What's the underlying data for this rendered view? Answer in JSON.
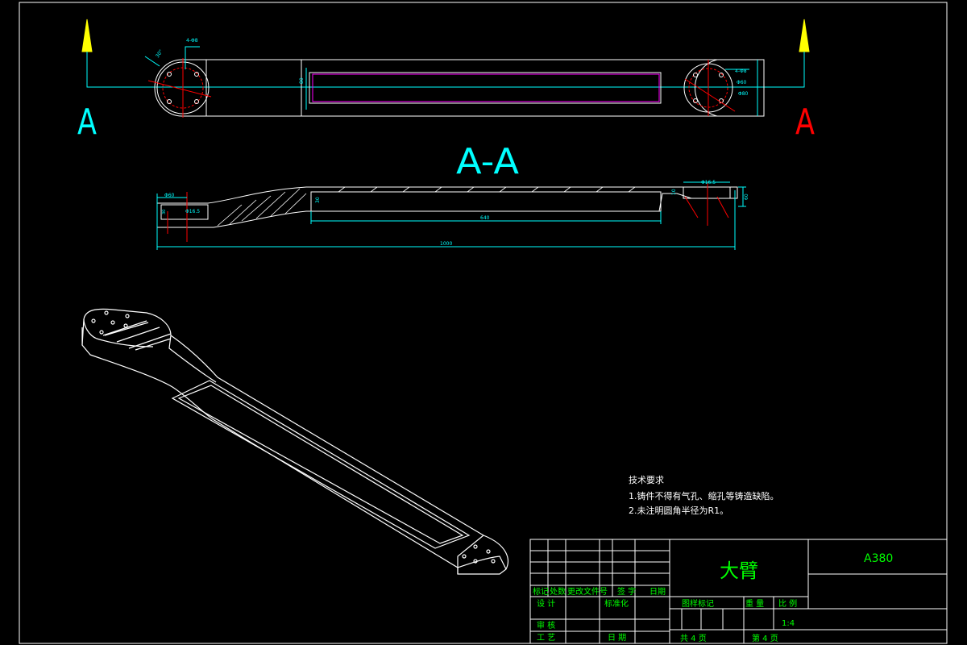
{
  "colors": {
    "background": "#000000",
    "line_white": "#ffffff",
    "dimension_cyan": "#00ffff",
    "section_red": "#ff0000",
    "slot_magenta": "#ff00ff",
    "arrow_yellow": "#ffff00",
    "title_green": "#00ff00"
  },
  "section_marks": {
    "left": "A",
    "right": "A",
    "title": "A-A"
  },
  "top_view_dims": {
    "hole_label_left": "4-Φ8",
    "hole_label_right": "4-Φ8",
    "angle_label": "30°",
    "thickness": "80",
    "right_dims": [
      "4-Φ8",
      "Φ60",
      "Φ80"
    ]
  },
  "section_dims": {
    "left_top": "Φ60",
    "left_hole": "Φ16.5",
    "left_depth": "30",
    "right_top": "Φ16.5",
    "right_height": "60",
    "right_small": "10",
    "slot_length": "640",
    "slot_depth": "30",
    "overall_length": "1000"
  },
  "technical_requirements": {
    "heading": "技术要求",
    "items": [
      "1.铸件不得有气孔、缩孔等铸造缺陷。",
      "2.未注明圆角半径为R1。"
    ]
  },
  "title_block": {
    "part_name": "大臂",
    "drawing_code": "A380",
    "rev_headers": [
      "标记",
      "处数",
      "更改文件号",
      "签 字",
      "日期"
    ],
    "left_rows": [
      {
        "label": "设 计",
        "label2": "标准化"
      },
      {
        "label": "审 核",
        "label2": ""
      },
      {
        "label": "工 艺",
        "label2": "日 期"
      }
    ],
    "stage_label": "图样标记",
    "weight_label": "重 量",
    "scale_label": "比 例",
    "scale_value": "1:4",
    "total_sheets": "共  4  页",
    "sheet_no": "第  4  页"
  }
}
